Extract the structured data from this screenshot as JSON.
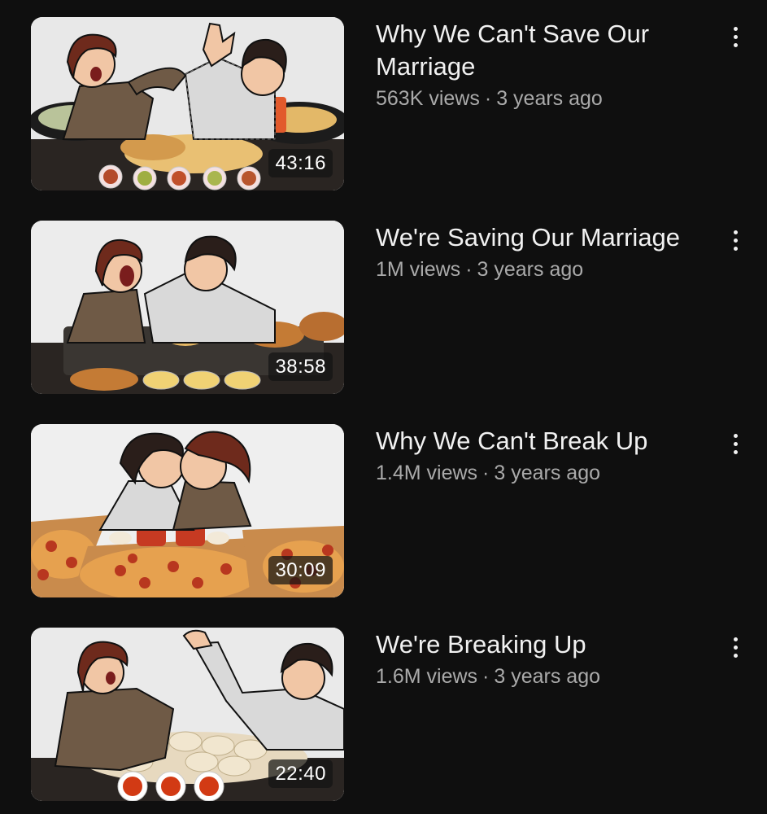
{
  "videos": [
    {
      "title": "Why We Can't Save Our Marriage",
      "views": "563K views",
      "age": "3 years ago",
      "duration": "43:16",
      "thumb_bg": "#e8e8e8"
    },
    {
      "title": "We're Saving Our Marriage",
      "views": "1M views",
      "age": "3 years ago",
      "duration": "38:58",
      "thumb_bg": "#ececec"
    },
    {
      "title": "Why We Can't Break Up",
      "views": "1.4M views",
      "age": "3 years ago",
      "duration": "30:09",
      "thumb_bg": "#efefef"
    },
    {
      "title": "We're Breaking Up",
      "views": "1.6M views",
      "age": "3 years ago",
      "duration": "22:40",
      "thumb_bg": "#eaeaea"
    }
  ],
  "separator": "·",
  "menu_icon": "more-vert-icon",
  "colors": {
    "background": "#0f0f0f",
    "title": "#f1f1f1",
    "subtitle": "#aaaaaa"
  }
}
